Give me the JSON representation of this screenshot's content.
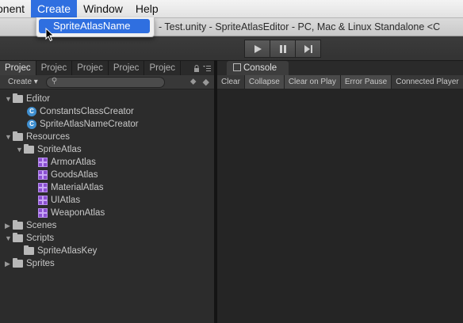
{
  "menubar": {
    "items": [
      "onent",
      "Create",
      "Window",
      "Help"
    ],
    "active_index": 1
  },
  "window_title": "- Test.unity - SpriteAtlasEditor - PC, Mac & Linux Standalone <C",
  "dropdown": {
    "items": [
      {
        "label": "SpriteAtlasName",
        "highlighted": true
      }
    ]
  },
  "toolbar": {
    "play_icon": "play-icon",
    "pause_icon": "pause-icon",
    "step_icon": "step-icon"
  },
  "project_panel": {
    "tabs": [
      "Projec",
      "Projec",
      "Projec",
      "Projec",
      "Projec"
    ],
    "active_tab": 0,
    "create_label": "Create",
    "search_placeholder": "",
    "tree": [
      {
        "label": "Editor",
        "type": "folder",
        "depth": 0,
        "expanded": true
      },
      {
        "label": "ConstantsClassCreator",
        "type": "script",
        "depth": 1
      },
      {
        "label": "SpriteAtlasNameCreator",
        "type": "script",
        "depth": 1
      },
      {
        "label": "Resources",
        "type": "folder",
        "depth": 0,
        "expanded": true
      },
      {
        "label": "SpriteAtlas",
        "type": "folder",
        "depth": 1,
        "expanded": true
      },
      {
        "label": "ArmorAtlas",
        "type": "atlas",
        "depth": 2
      },
      {
        "label": "GoodsAtlas",
        "type": "atlas",
        "depth": 2
      },
      {
        "label": "MaterialAtlas",
        "type": "atlas",
        "depth": 2
      },
      {
        "label": "UIAtlas",
        "type": "atlas",
        "depth": 2
      },
      {
        "label": "WeaponAtlas",
        "type": "atlas",
        "depth": 2
      },
      {
        "label": "Scenes",
        "type": "folder",
        "depth": 0,
        "expanded": false
      },
      {
        "label": "Scripts",
        "type": "folder",
        "depth": 0,
        "expanded": true
      },
      {
        "label": "SpriteAtlasKey",
        "type": "folder",
        "depth": 1
      },
      {
        "label": "Sprites",
        "type": "folder",
        "depth": 0,
        "expanded": false
      }
    ]
  },
  "console_panel": {
    "tab_label": "Console",
    "buttons": [
      {
        "label": "Clear",
        "active": false
      },
      {
        "label": "Collapse",
        "active": true
      },
      {
        "label": "Clear on Play",
        "active": true
      },
      {
        "label": "Error Pause",
        "active": true
      },
      {
        "label": "Connected Player",
        "active": false
      }
    ]
  },
  "colors": {
    "menu_highlight": "#2f6fe0",
    "atlas_icon": "#8a4fd0",
    "script_icon": "#3f8fd0"
  }
}
